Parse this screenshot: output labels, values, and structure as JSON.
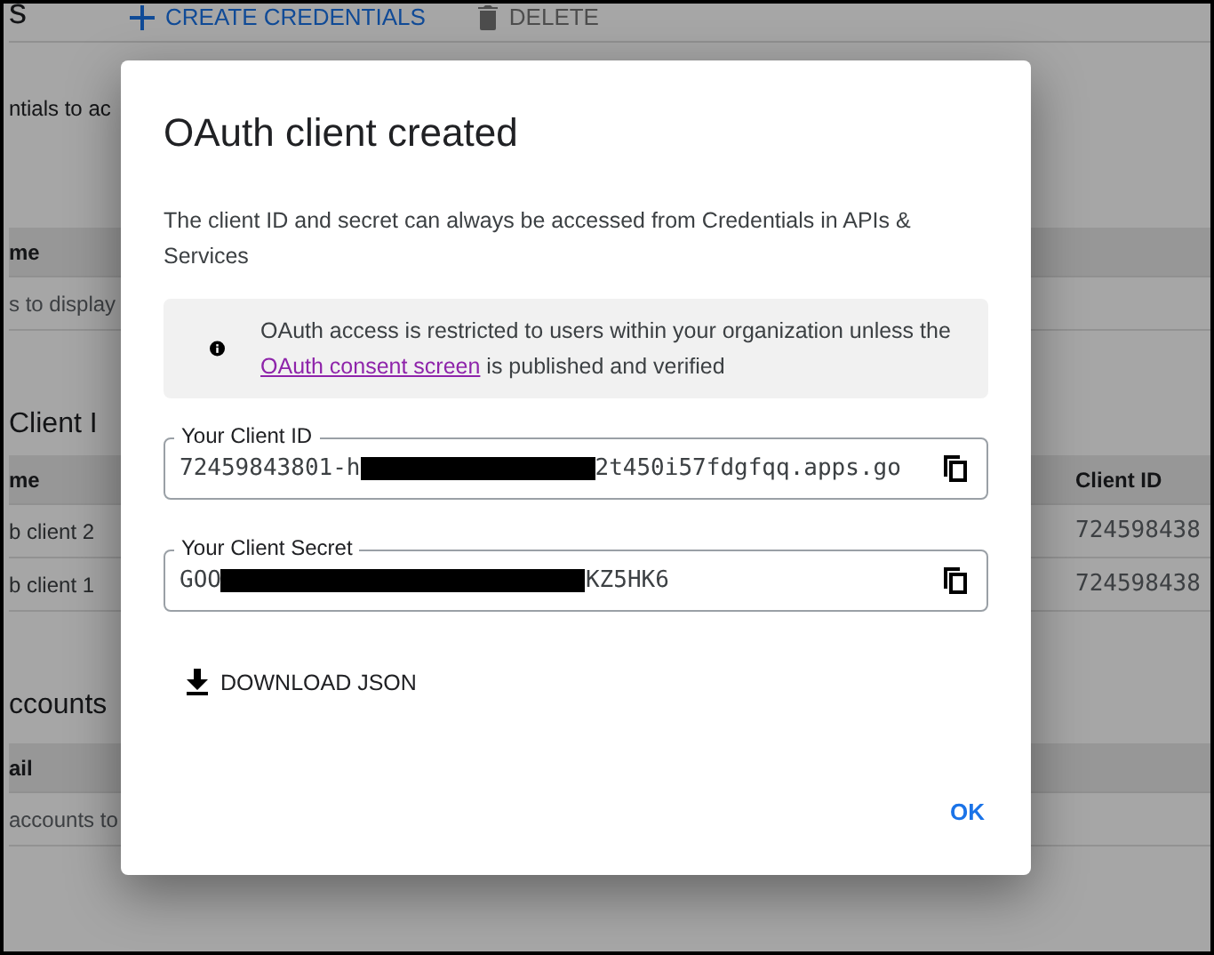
{
  "page": {
    "header_title": "s",
    "toolbar": [
      {
        "kind": "add",
        "label": "CREATE CREDENTIALS",
        "disabled": false
      },
      {
        "kind": "delete",
        "label": "DELETE",
        "disabled": true
      }
    ],
    "intro": "ntials to ac",
    "api_keys": {
      "columns": [
        "me"
      ],
      "empty": "s to display"
    },
    "oauth": {
      "heading": "Client I",
      "columns": [
        "me",
        "Client ID"
      ],
      "rows": [
        [
          "b client 2",
          "724598438"
        ],
        [
          "b client 1",
          "724598438"
        ]
      ]
    },
    "accounts": {
      "heading": "ccounts",
      "columns": [
        "ail"
      ],
      "empty": "accounts to"
    }
  },
  "dialog": {
    "title": "OAuth client created",
    "description": "The client ID and secret can always be accessed from Credentials in APIs & Services",
    "notice": {
      "before": "OAuth access is restricted to users within your organization unless the ",
      "link": "OAuth consent screen",
      "after": " is published and verified"
    },
    "fields": [
      {
        "label": "Your Client ID",
        "value_start": "72459843801-h",
        "value_end": "2t450i57fdgfqq.apps.go",
        "redacted": true
      },
      {
        "label": "Your Client Secret",
        "value_start": "GOO",
        "value_end": "KZ5HK6",
        "redacted": true
      }
    ],
    "download": "DOWNLOAD JSON",
    "ok": "OK"
  }
}
